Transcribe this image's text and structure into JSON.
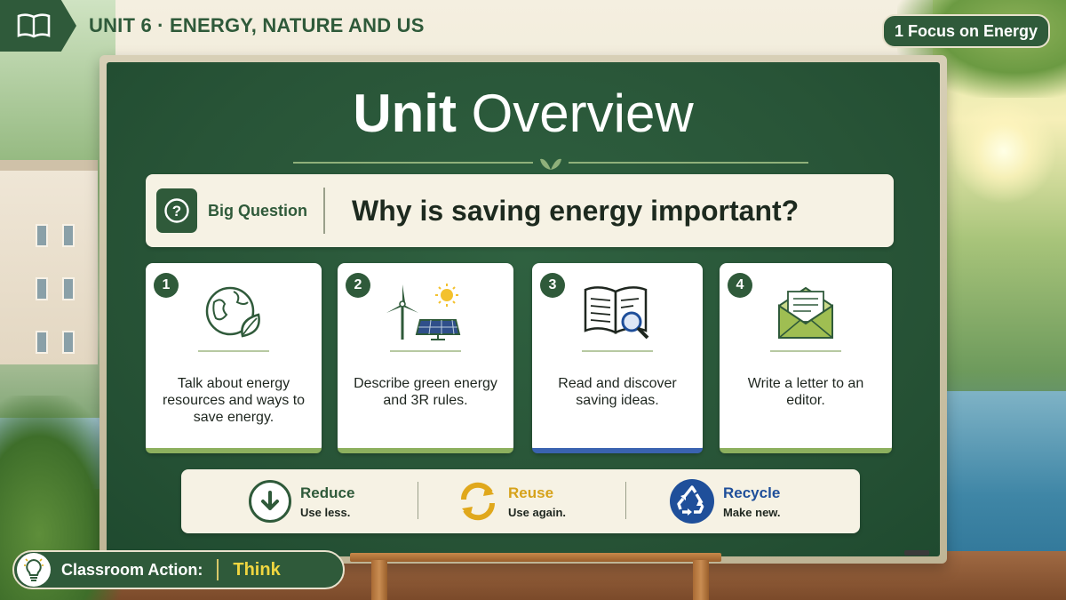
{
  "header": {
    "unit_title": "UNIT 6 · ENERGY, NATURE AND US",
    "focus_label": "1 Focus on Energy"
  },
  "board": {
    "title_bold": "Unit",
    "title_light": "Overview"
  },
  "big_question": {
    "label": "Big Question",
    "question": "Why is saving energy important?"
  },
  "goals": [
    {
      "number": "1",
      "text": "Talk about energy resources and ways to save energy.",
      "icon": "globe-leaf-icon",
      "accent": "#8db05e"
    },
    {
      "number": "2",
      "text": "Describe green energy and 3R rules.",
      "icon": "wind-solar-icon",
      "accent": "#8db05e"
    },
    {
      "number": "3",
      "text": "Read and discover saving ideas.",
      "icon": "book-magnifier-icon",
      "accent": "#3a63b0"
    },
    {
      "number": "4",
      "text": "Write a letter to an editor.",
      "icon": "envelope-letter-icon",
      "accent": "#8db05e"
    }
  ],
  "three_r": [
    {
      "title": "Reduce",
      "subtitle": "Use less.",
      "icon": "down-arrow-icon",
      "color": "#2f5a3a"
    },
    {
      "title": "Reuse",
      "subtitle": "Use again.",
      "icon": "circular-arrows-icon",
      "color": "#d6a21a"
    },
    {
      "title": "Recycle",
      "subtitle": "Make new.",
      "icon": "recycle-icon",
      "color": "#1f4f9a"
    }
  ],
  "classroom_action": {
    "label": "Classroom Action:",
    "value": "Think"
  },
  "colors": {
    "board_green": "#285437",
    "brand_green": "#2f5a3a",
    "think_yellow": "#f0d640"
  }
}
